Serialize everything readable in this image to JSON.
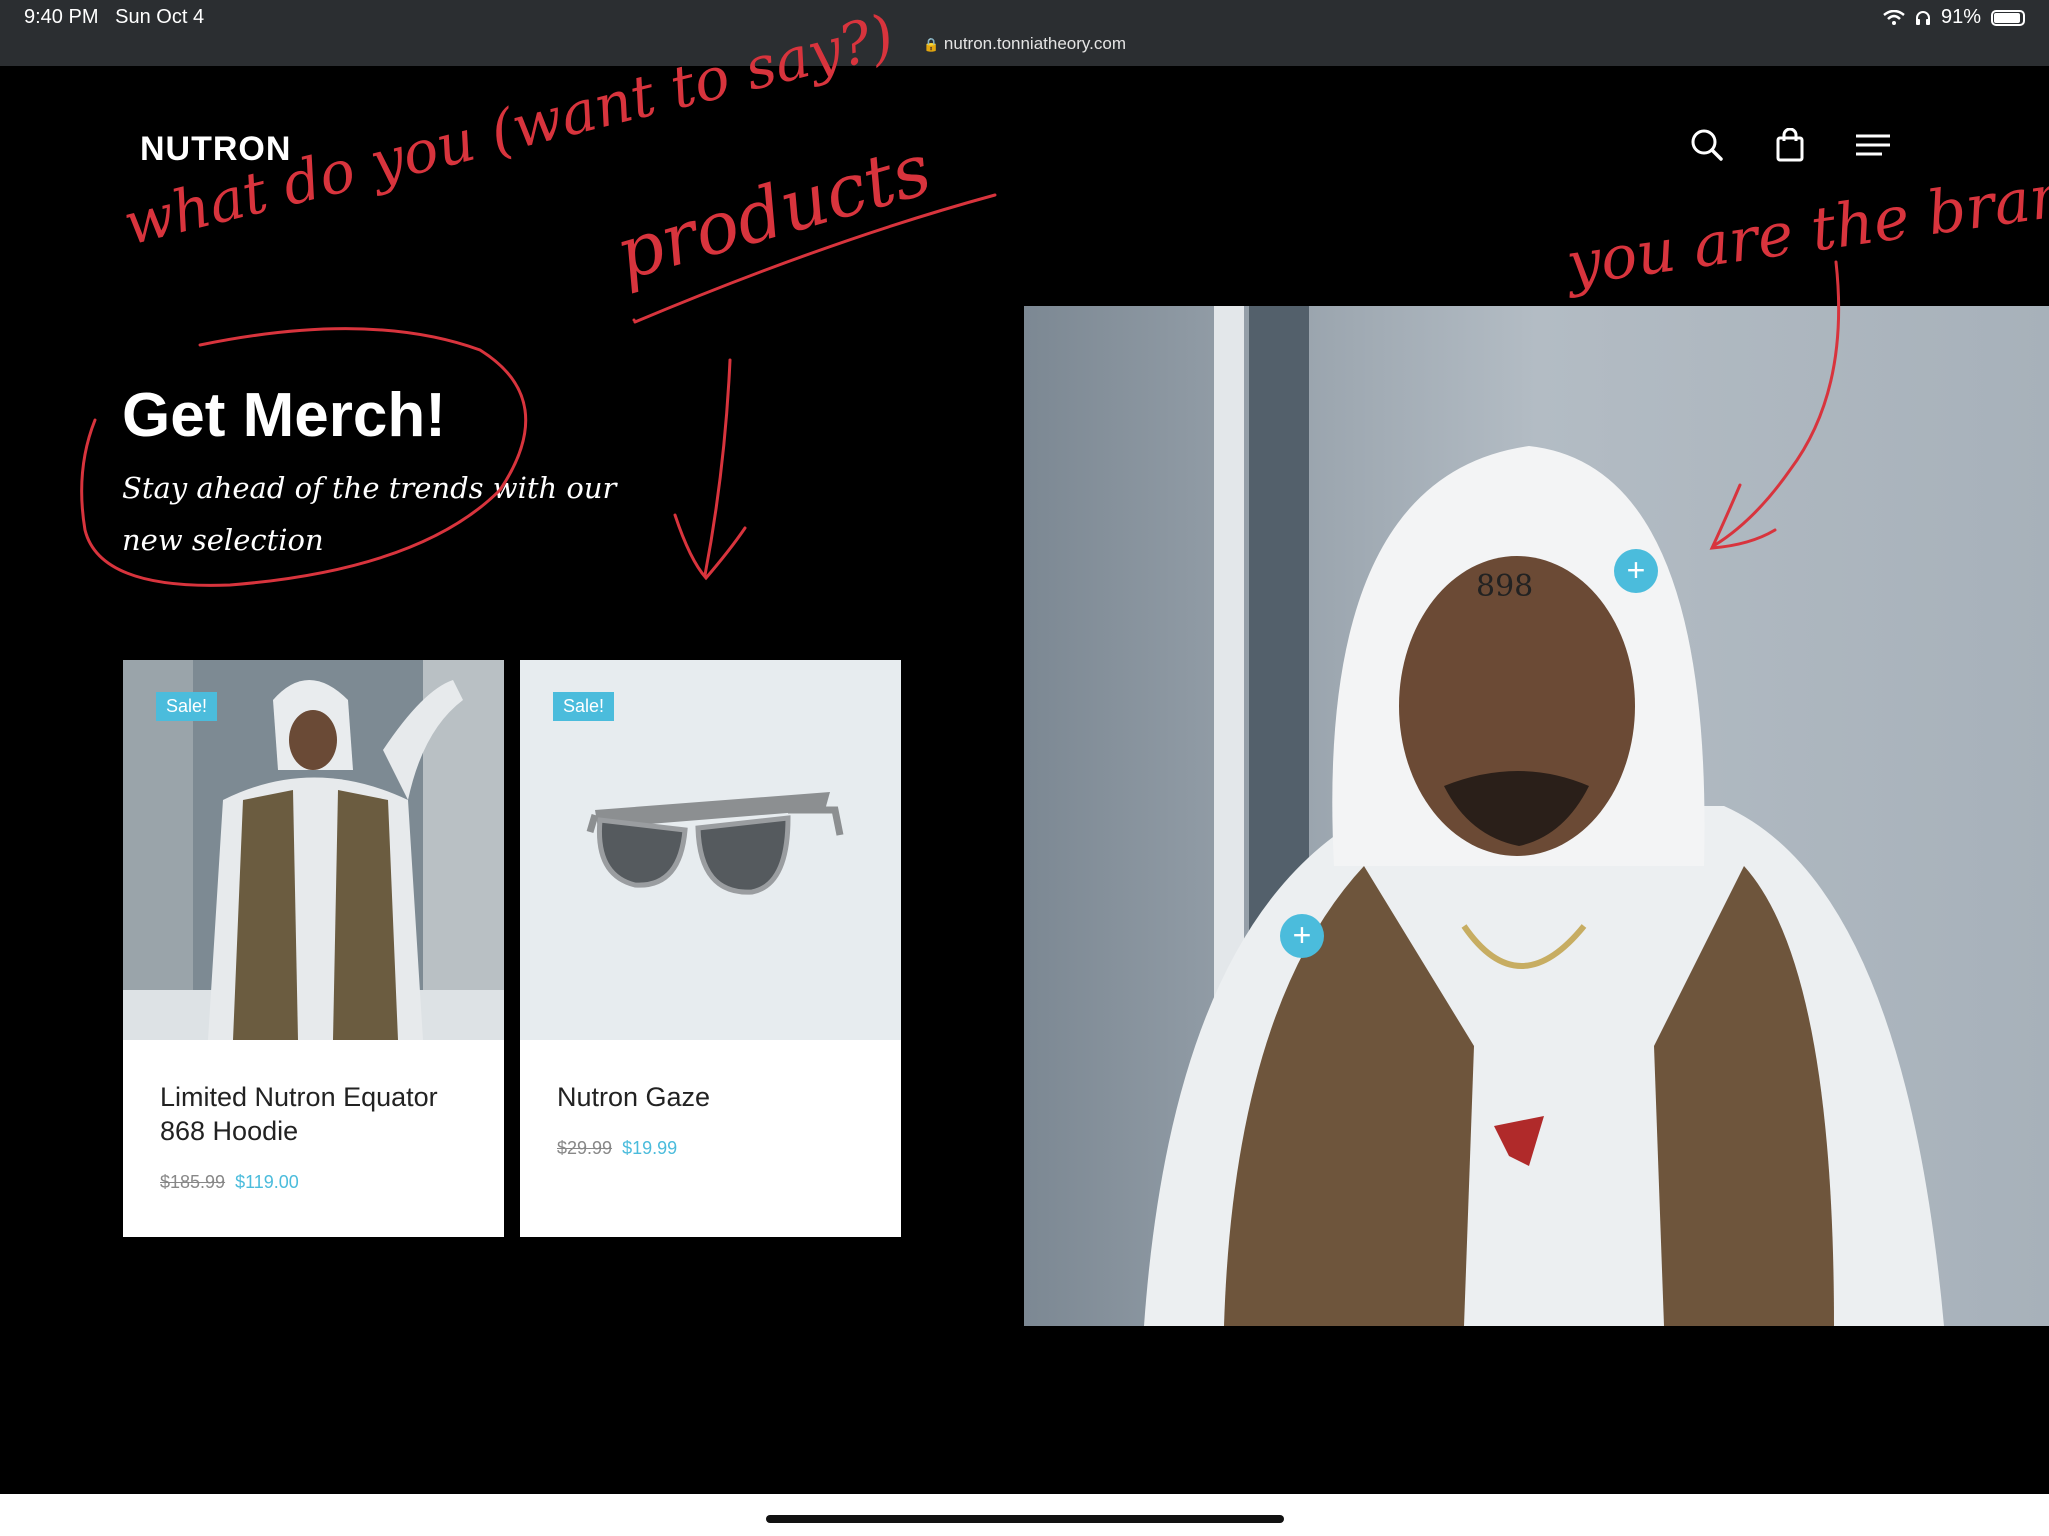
{
  "status_bar": {
    "time": "9:40 PM",
    "date": "Sun Oct 4",
    "battery": "91%"
  },
  "browser": {
    "url": "nutron.tonniatheory.com"
  },
  "header": {
    "logo": "NUTRON",
    "icons": [
      "search-icon",
      "shopping-bag-icon",
      "menu-icon"
    ]
  },
  "hero": {
    "title": "Get Merch!",
    "subtitle": "Stay ahead of the trends with our new selection"
  },
  "products": [
    {
      "badge": "Sale!",
      "name": "Limited Nutron Equator 868 Hoodie",
      "old_price": "$185.99",
      "price": "$119.00"
    },
    {
      "badge": "Sale!",
      "name": "Nutron Gaze",
      "old_price": "$29.99",
      "price": "$19.99"
    }
  ],
  "hotspots": [
    {
      "label": "+"
    },
    {
      "label": "+"
    }
  ],
  "annotations": {
    "note1": "what do you (want to say?)",
    "note2": "products",
    "note3": "you are the brand!"
  },
  "colors": {
    "accent": "#4bbcdc",
    "background": "#000000",
    "annotation": "#d8343d"
  }
}
